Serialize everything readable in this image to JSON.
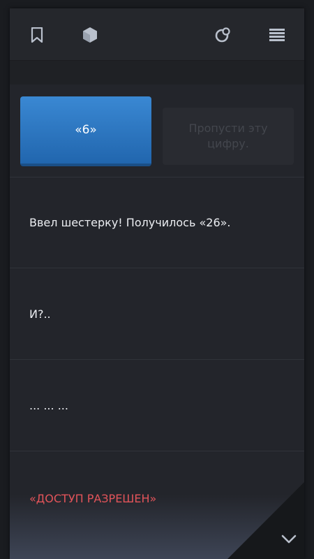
{
  "toolbar": {
    "icons": [
      "bookmark-icon",
      "cube-icon",
      "achievement-icon",
      "menu-icon"
    ]
  },
  "choices": {
    "primary_label": "«6»",
    "disabled_label": "Пропусти эту цифру."
  },
  "messages": [
    "Ввел шестерку! Получилось «26».",
    "И?..",
    "... ... ...",
    "«ДОСТУП РАЗРЕШЕН»"
  ],
  "colors": {
    "accent": "#2f7ac6",
    "alert": "#e2545a",
    "background": "#23252b"
  }
}
